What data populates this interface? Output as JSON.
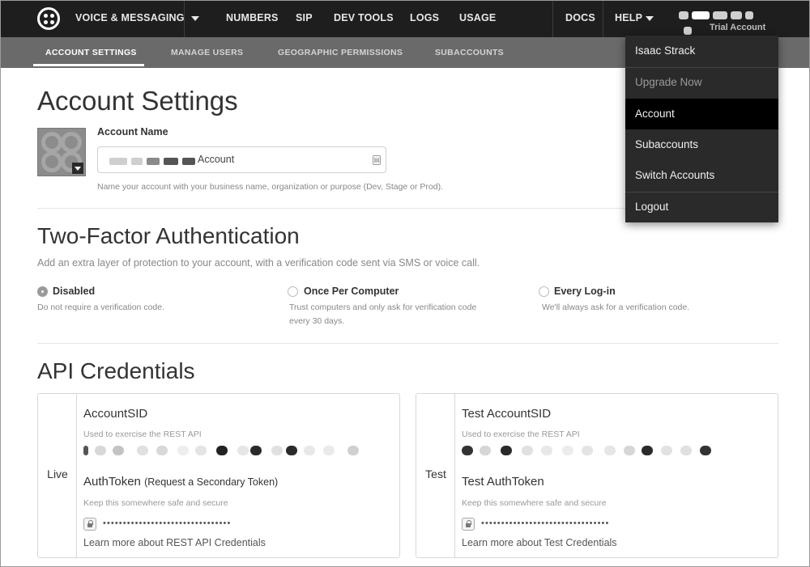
{
  "topnav": {
    "items": [
      {
        "label": "VOICE & MESSAGING"
      },
      {
        "label": "NUMBERS"
      },
      {
        "label": "SIP"
      },
      {
        "label": "DEV TOOLS"
      },
      {
        "label": "LOGS"
      },
      {
        "label": "USAGE"
      }
    ],
    "docs": "DOCS",
    "help": "HELP",
    "trial": "Trial Account"
  },
  "subnav": {
    "items": [
      {
        "label": "ACCOUNT SETTINGS",
        "active": true
      },
      {
        "label": "MANAGE USERS"
      },
      {
        "label": "GEOGRAPHIC PERMISSIONS"
      },
      {
        "label": "SUBACCOUNTS"
      }
    ]
  },
  "account": {
    "title": "Account Settings",
    "name_label": "Account Name",
    "name_value": "Account",
    "help": "Name your account with your business name, organization or purpose (Dev, Stage or Prod)."
  },
  "twofactor": {
    "title": "Two-Factor Authentication",
    "description": "Add an extra layer of protection to your account, with a verification code sent via SMS or voice call.",
    "options": [
      {
        "label": "Disabled",
        "desc": "Do not require a verification code.",
        "selected": true
      },
      {
        "label": "Once Per Computer",
        "desc": "Trust computers and only ask for verification code every 30 days.",
        "selected": false
      },
      {
        "label": "Every Log-in",
        "desc": "We'll always ask for a verification code.",
        "selected": false
      }
    ]
  },
  "api": {
    "title": "API Credentials",
    "live": {
      "side": "Live",
      "sid_title": "AccountSID",
      "sid_desc": "Used to exercise the REST API",
      "token_title": "AuthToken",
      "token_extra": "(Request a Secondary Token)",
      "token_desc": "Keep this somewhere safe and secure",
      "masked": "••••••••••••••••••••••••••••••••",
      "link": "Learn more about REST API Credentials"
    },
    "test": {
      "side": "Test",
      "sid_title": "Test AccountSID",
      "sid_desc": "Used to exercise the REST API",
      "token_title": "Test AuthToken",
      "token_desc": "Keep this somewhere safe and secure",
      "masked": "••••••••••••••••••••••••••••••••",
      "link": "Learn more about Test Credentials"
    }
  },
  "dropdown": {
    "items": [
      {
        "label": "Isaac Strack"
      },
      {
        "label": "Upgrade Now",
        "muted": true
      },
      {
        "label": "Account",
        "active": true
      },
      {
        "label": "Subaccounts"
      },
      {
        "label": "Switch Accounts"
      },
      {
        "label": "Logout"
      }
    ]
  },
  "icons": [
    "twilio-logo-icon",
    "chevron-down-icon",
    "lock-icon",
    "contact-card-icon"
  ]
}
